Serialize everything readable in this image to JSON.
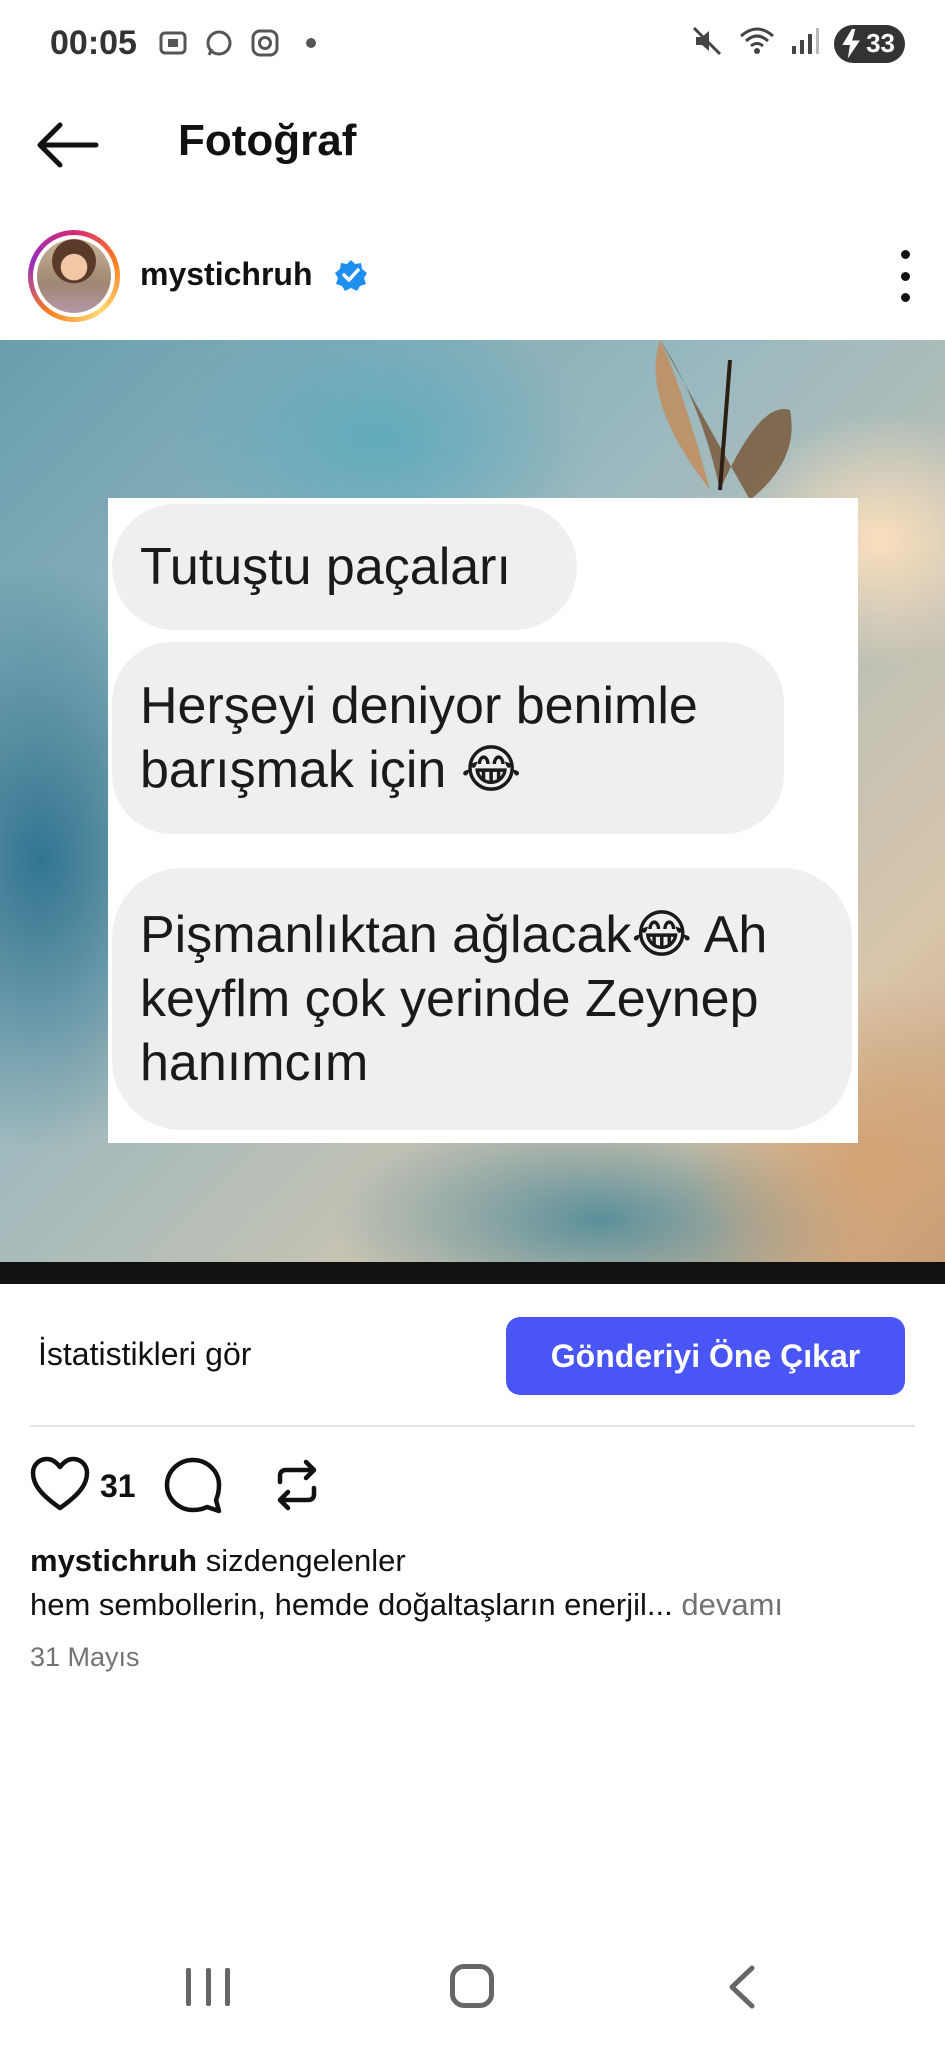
{
  "status_bar": {
    "time": "00:05",
    "battery_level": "33"
  },
  "header": {
    "title": "Fotoğraf"
  },
  "post": {
    "author": "mystichruh",
    "verified": true,
    "image_messages": [
      "Tutuştu paçaları",
      "Herşeyi deniyor benimle\nbarışmak için 😂",
      "Pişmanlıktan ağlacak😂 Ah\nkeyflm çok yerinde Zeynep\nhanımcım"
    ]
  },
  "actions": {
    "stats_label": "İstatistikleri gör",
    "boost_label": "Gönderiyi Öne Çıkar",
    "boost_color": "#4a55f5"
  },
  "reactions": {
    "like_count": "31"
  },
  "caption": {
    "username": "mystichruh",
    "first_line": "sizdengelenler",
    "text": "hem sembollerin, hemde doğaltaşların enerjil...",
    "more_label": "devamı",
    "date": "31 Mayıs"
  },
  "icons": [
    "back-arrow-icon",
    "verified-icon",
    "more-vertical-icon",
    "heart-icon",
    "comment-icon",
    "repost-icon"
  ]
}
